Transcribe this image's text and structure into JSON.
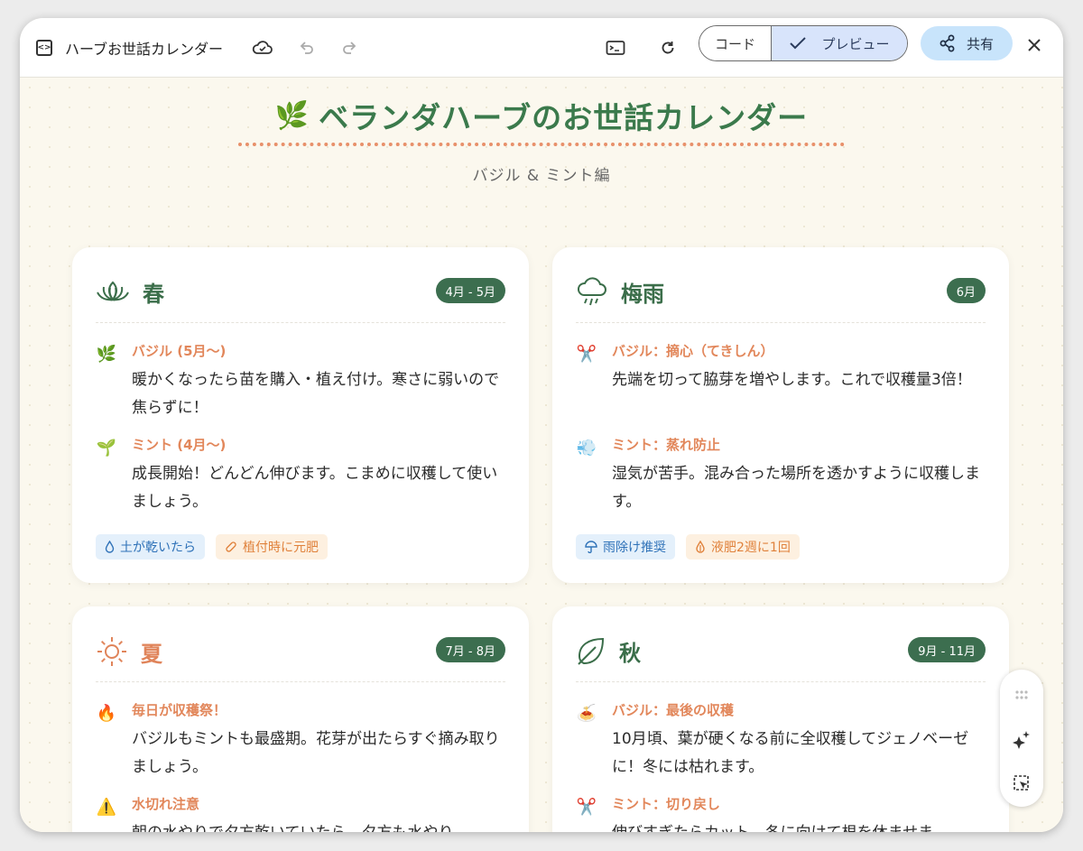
{
  "app": {
    "title": "ハーブお世話カレンダー"
  },
  "toolbar": {
    "code_label": "コード",
    "preview_label": "プレビュー",
    "share_label": "共有"
  },
  "page": {
    "title": "ベランダハーブのお世話カレンダー",
    "title_icon": "🌿",
    "subtitle": "バジル & ミント編"
  },
  "seasons": [
    {
      "name": "春",
      "period": "4月 - 5月",
      "icon": "lotus-icon",
      "items": [
        {
          "icon": "🌿",
          "title": "バジル (5月〜)",
          "text": "暖かくなったら苗を購入・植え付け。寒さに弱いので焦らずに！"
        },
        {
          "icon": "🌱",
          "title": "ミント (4月〜)",
          "text": "成長開始！どんどん伸びます。こまめに収穫して使いましょう。"
        }
      ],
      "tags": [
        {
          "icon": "droplet-icon",
          "label": "土が乾いたら"
        },
        {
          "icon": "pill-icon",
          "label": "植付時に元肥"
        }
      ]
    },
    {
      "name": "梅雨",
      "period": "6月",
      "icon": "rain-cloud-icon",
      "items": [
        {
          "icon": "✂️",
          "title": "バジル：摘心（てきしん）",
          "text": "先端を切って脇芽を増やします。これで収穫量3倍！"
        },
        {
          "icon": "💨",
          "title": "ミント：蒸れ防止",
          "text": "湿気が苦手。混み合った場所を透かすように収穫します。"
        }
      ],
      "tags": [
        {
          "icon": "umbrella-icon",
          "label": "雨除け推奨"
        },
        {
          "icon": "fertilizer-drop-icon",
          "label": "液肥2週に1回"
        }
      ]
    },
    {
      "name": "夏",
      "period": "7月 - 8月",
      "icon": "sun-icon",
      "items": [
        {
          "icon": "🔥",
          "title": "毎日が収穫祭！",
          "text": "バジルもミントも最盛期。花芽が出たらすぐ摘み取りましょう。"
        },
        {
          "icon": "⚠️",
          "title": "水切れ注意",
          "text": "朝の水やりで夕方乾いていたら、夕方も水やり"
        }
      ]
    },
    {
      "name": "秋",
      "period": "9月 - 11月",
      "icon": "leaf-icon",
      "items": [
        {
          "icon": "🍝",
          "title": "バジル：最後の収穫",
          "text": "10月頃、葉が硬くなる前に全収穫してジェノベーゼに！冬には枯れます。"
        },
        {
          "icon": "✂️",
          "title": "ミント：切り戻し",
          "text": "伸びすぎたらカット。冬に向けて根を休ませま"
        }
      ]
    }
  ]
}
